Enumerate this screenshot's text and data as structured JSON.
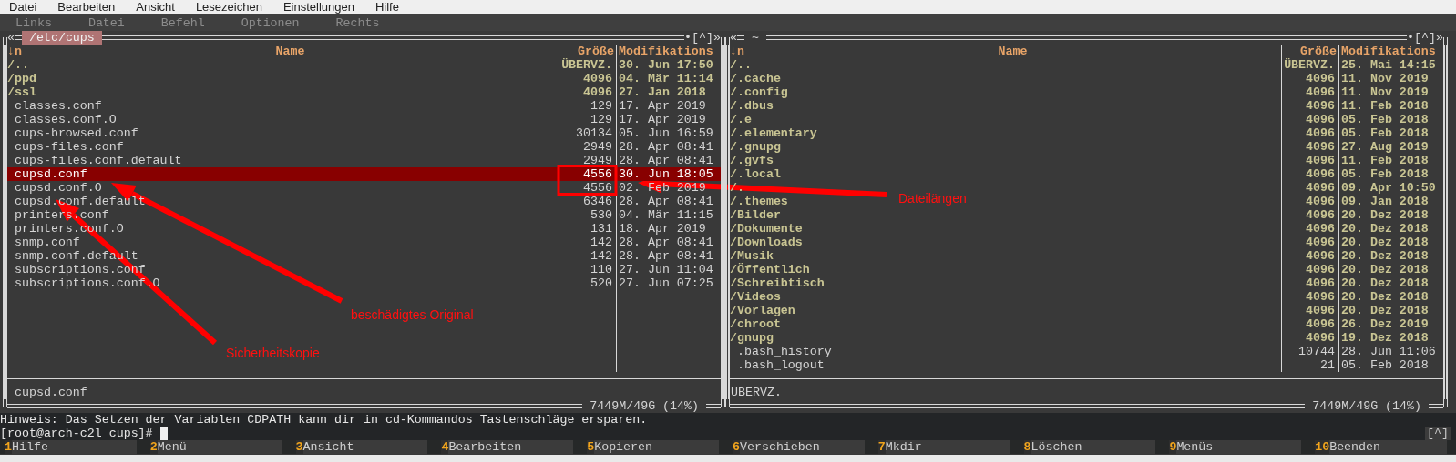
{
  "app_menu": [
    "Datei",
    "Bearbeiten",
    "Ansicht",
    "Lesezeichen",
    "Einstellungen",
    "Hilfe"
  ],
  "mc_menu": [
    "Links",
    "Datei",
    "Befehl",
    "Optionen",
    "Rechts"
  ],
  "panels": [
    {
      "path": "/etc/cups",
      "active": true,
      "left_mark": "«",
      "right_mark": "•[^]»",
      "columns": [
        "↓n",
        "Name",
        "Größe",
        "Modifikations"
      ],
      "rows": [
        {
          "name": "/..",
          "size": "ÜBERVZ.",
          "modified": "30. Jun 17:50",
          "kind": "dir",
          "selected": false
        },
        {
          "name": "/ppd",
          "size": "4096",
          "modified": "04. Mär 11:14",
          "kind": "dir",
          "selected": false
        },
        {
          "name": "/ssl",
          "size": "4096",
          "modified": "27. Jan 2018",
          "kind": "dir",
          "selected": false
        },
        {
          "name": "classes.conf",
          "size": "129",
          "modified": "17. Apr 2019",
          "kind": "file",
          "selected": false
        },
        {
          "name": "classes.conf.O",
          "size": "129",
          "modified": "17. Apr 2019",
          "kind": "file",
          "selected": false
        },
        {
          "name": "cups-browsed.conf",
          "size": "30134",
          "modified": "05. Jun 16:59",
          "kind": "file",
          "selected": false
        },
        {
          "name": "cups-files.conf",
          "size": "2949",
          "modified": "28. Apr 08:41",
          "kind": "file",
          "selected": false
        },
        {
          "name": "cups-files.conf.default",
          "size": "2949",
          "modified": "28. Apr 08:41",
          "kind": "file",
          "selected": false
        },
        {
          "name": "cupsd.conf",
          "size": "4556",
          "modified": "30. Jun 18:05",
          "kind": "file",
          "selected": true
        },
        {
          "name": "cupsd.conf.O",
          "size": "4556",
          "modified": "02. Feb 2019",
          "kind": "file",
          "selected": false
        },
        {
          "name": "cupsd.conf.default",
          "size": "6346",
          "modified": "28. Apr 08:41",
          "kind": "file",
          "selected": false
        },
        {
          "name": "printers.conf",
          "size": "530",
          "modified": "04. Mär 11:15",
          "kind": "file",
          "selected": false
        },
        {
          "name": "printers.conf.O",
          "size": "131",
          "modified": "18. Apr 2019",
          "kind": "file",
          "selected": false
        },
        {
          "name": "snmp.conf",
          "size": "142",
          "modified": "28. Apr 08:41",
          "kind": "file",
          "selected": false
        },
        {
          "name": "snmp.conf.default",
          "size": "142",
          "modified": "28. Apr 08:41",
          "kind": "file",
          "selected": false
        },
        {
          "name": "subscriptions.conf",
          "size": "110",
          "modified": "27. Jun 11:04",
          "kind": "file",
          "selected": false
        },
        {
          "name": "subscriptions.conf.O",
          "size": "520",
          "modified": "27. Jun 07:25",
          "kind": "file",
          "selected": false
        }
      ],
      "status": "cupsd.conf",
      "disk": "7449M/49G (14%)"
    },
    {
      "path": "~",
      "active": false,
      "left_mark": "«",
      "right_mark": "•[^]»",
      "columns": [
        "↓n",
        "Name",
        "Größe",
        "Modifikations"
      ],
      "rows": [
        {
          "name": "/..",
          "size": "ÜBERVZ.",
          "modified": "25. Mai 14:15",
          "kind": "dir",
          "selected": false
        },
        {
          "name": "/.cache",
          "size": "4096",
          "modified": "11. Nov 2019",
          "kind": "dir",
          "selected": false
        },
        {
          "name": "/.config",
          "size": "4096",
          "modified": "11. Nov 2019",
          "kind": "dir",
          "selected": false
        },
        {
          "name": "/.dbus",
          "size": "4096",
          "modified": "11. Feb 2018",
          "kind": "dir",
          "selected": false
        },
        {
          "name": "/.e",
          "size": "4096",
          "modified": "05. Feb 2018",
          "kind": "dir",
          "selected": false
        },
        {
          "name": "/.elementary",
          "size": "4096",
          "modified": "05. Feb 2018",
          "kind": "dir",
          "selected": false
        },
        {
          "name": "/.gnupg",
          "size": "4096",
          "modified": "27. Aug 2019",
          "kind": "dir",
          "selected": false
        },
        {
          "name": "/.gvfs",
          "size": "4096",
          "modified": "11. Feb 2018",
          "kind": "dir",
          "selected": false
        },
        {
          "name": "/.local",
          "size": "4096",
          "modified": "05. Feb 2018",
          "kind": "dir",
          "selected": false
        },
        {
          "name": "/.",
          "size": "4096",
          "modified": "09. Apr 10:50",
          "kind": "dir",
          "selected": false
        },
        {
          "name": "/.themes",
          "size": "4096",
          "modified": "09. Jan 2018",
          "kind": "dir",
          "selected": false
        },
        {
          "name": "/Bilder",
          "size": "4096",
          "modified": "20. Dez 2018",
          "kind": "dir",
          "selected": false
        },
        {
          "name": "/Dokumente",
          "size": "4096",
          "modified": "20. Dez 2018",
          "kind": "dir",
          "selected": false
        },
        {
          "name": "/Downloads",
          "size": "4096",
          "modified": "20. Dez 2018",
          "kind": "dir",
          "selected": false
        },
        {
          "name": "/Musik",
          "size": "4096",
          "modified": "20. Dez 2018",
          "kind": "dir",
          "selected": false
        },
        {
          "name": "/Öffentlich",
          "size": "4096",
          "modified": "20. Dez 2018",
          "kind": "dir",
          "selected": false
        },
        {
          "name": "/Schreibtisch",
          "size": "4096",
          "modified": "20. Dez 2018",
          "kind": "dir",
          "selected": false
        },
        {
          "name": "/Videos",
          "size": "4096",
          "modified": "20. Dez 2018",
          "kind": "dir",
          "selected": false
        },
        {
          "name": "/Vorlagen",
          "size": "4096",
          "modified": "20. Dez 2018",
          "kind": "dir",
          "selected": false
        },
        {
          "name": "/chroot",
          "size": "4096",
          "modified": "26. Dez 2019",
          "kind": "dir",
          "selected": false
        },
        {
          "name": "/gnupg",
          "size": "4096",
          "modified": "19. Dez 2018",
          "kind": "dir",
          "selected": false
        },
        {
          "name": ".bash_history",
          "size": "10744",
          "modified": "28. Jun 11:06",
          "kind": "file",
          "selected": false
        },
        {
          "name": ".bash_logout",
          "size": "21",
          "modified": "05. Feb 2018",
          "kind": "file",
          "selected": false
        }
      ],
      "status": "ÜBERVZ.",
      "disk": "7449M/49G (14%)"
    }
  ],
  "hint": "Hinweis: Das Setzen der Variablen CDPATH kann dir in cd-Kommandos Tastenschläge ersparen.",
  "prompt": "[root@arch-c2l cups]#",
  "scroll_marker": "[^]",
  "function_keys": [
    {
      "key": "1",
      "label": "Hilfe"
    },
    {
      "key": "2",
      "label": "Menü"
    },
    {
      "key": "3",
      "label": "Ansicht"
    },
    {
      "key": "4",
      "label": "Bearbeiten"
    },
    {
      "key": "5",
      "label": "Kopieren"
    },
    {
      "key": "6",
      "label": "Verschieben"
    },
    {
      "key": "7",
      "label": "Mkdir"
    },
    {
      "key": "8",
      "label": "Löschen"
    },
    {
      "key": "9",
      "label": "Menüs"
    },
    {
      "key": "10",
      "label": "Beenden"
    }
  ],
  "annotations": [
    {
      "text": "Dateilängen"
    },
    {
      "text": "beschädigtes Original"
    },
    {
      "text": "Sicherheitskopie"
    }
  ]
}
